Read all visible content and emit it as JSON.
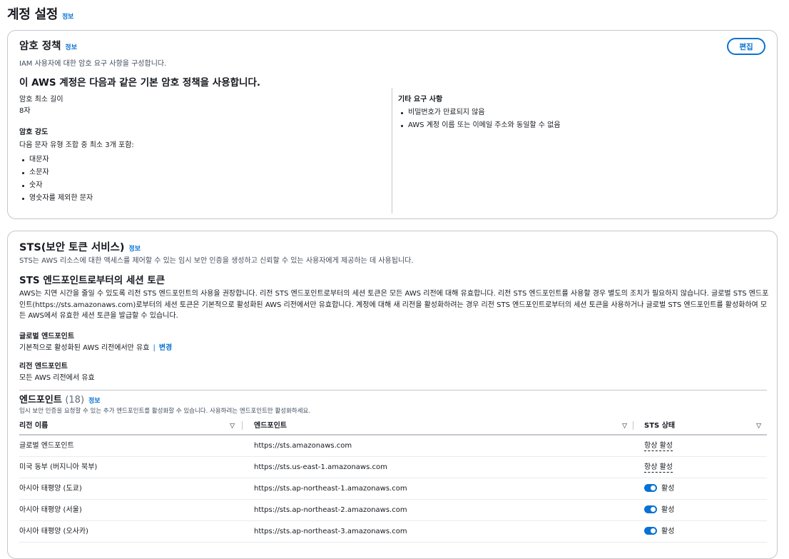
{
  "page": {
    "title": "계정 설정",
    "info": "정보"
  },
  "password_policy": {
    "title": "암호 정책",
    "info": "정보",
    "description": "IAM 사용자에 대한 암호 요구 사항을 구성합니다.",
    "edit_label": "편집",
    "heading": "이 AWS 계정은 다음과 같은 기본 암호 정책을 사용합니다.",
    "min_length_label": "암호 최소 길이",
    "min_length_value": "8자",
    "strength_label": "암호 강도",
    "strength_desc": "다음 문자 유형 조합 중 최소 3개 포함:",
    "strength_items": [
      "대문자",
      "소문자",
      "숫자",
      "영숫자를 제외한 문자"
    ],
    "other_label": "기타 요구 사항",
    "other_items": [
      "비밀번호가 만료되지 않음",
      "AWS 계정 이름 또는 이메일 주소와 동일할 수 없음"
    ]
  },
  "sts": {
    "title": "STS(보안 토큰 서비스)",
    "info": "정보",
    "description": "STS는 AWS 리소스에 대한 액세스를 제어할 수 있는 임시 보안 인증을 생성하고 신뢰할 수 있는 사용자에게 제공하는 데 사용됩니다.",
    "session_heading": "STS 엔드포인트로부터의 세션 토큰",
    "session_paragraph": "AWS는 지연 시간을 줄일 수 있도록 리전 STS 엔드포인트의 사용을 권장합니다. 리전 STS 엔드포인트로부터의 세션 토큰은 모든 AWS 리전에 대해 유효합니다. 리전 STS 엔드포인트를 사용할 경우 별도의 조치가 필요하지 않습니다. 글로벌 STS 엔드포인트(https://sts.amazonaws.com)로부터의 세션 토큰은 기본적으로 활성화된 AWS 리전에서만 유효합니다. 계정에 대해 새 리전을 활성화하려는 경우 리전 STS 엔드포인트로부터의 세션 토큰을 사용하거나 글로벌 STS 엔드포인트를 활성화하여 모든 AWS에서 유효한 세션 토큰을 발급할 수 있습니다.",
    "global_label": "글로벌 엔드포인트",
    "global_value": "기본적으로 활성화된 AWS 리전에서만 유효",
    "global_sep": "|",
    "global_change": "변경",
    "regional_label": "리전 엔드포인트",
    "regional_value": "모든 AWS 리전에서 유효"
  },
  "endpoints": {
    "title": "엔드포인트",
    "count": "(18)",
    "info": "정보",
    "description": "임시 보안 인증을 요청할 수 있는 추가 엔드포인트를 활성화할 수 있습니다. 사용하려는 엔드포인트만 활성화하세요.",
    "columns": [
      "리전 이름",
      "엔드포인트",
      "STS 상태"
    ],
    "rows": [
      {
        "region": "글로벌 엔드포인트",
        "endpoint": "https://sts.amazonaws.com",
        "status": "항상 활성",
        "toggle": false
      },
      {
        "region": "미국 동부 (버지니아 북부)",
        "endpoint": "https://sts.us-east-1.amazonaws.com",
        "status": "항상 활성",
        "toggle": false
      },
      {
        "region": "아시아 태평양 (도쿄)",
        "endpoint": "https://sts.ap-northeast-1.amazonaws.com",
        "status": "활성",
        "toggle": true
      },
      {
        "region": "아시아 태평양 (서울)",
        "endpoint": "https://sts.ap-northeast-2.amazonaws.com",
        "status": "활성",
        "toggle": true
      },
      {
        "region": "아시아 태평양 (오사카)",
        "endpoint": "https://sts.ap-northeast-3.amazonaws.com",
        "status": "활성",
        "toggle": true
      }
    ]
  },
  "colors": {
    "accent": "#0972d3",
    "border": "#c6c6cd",
    "text": "#16191f"
  }
}
